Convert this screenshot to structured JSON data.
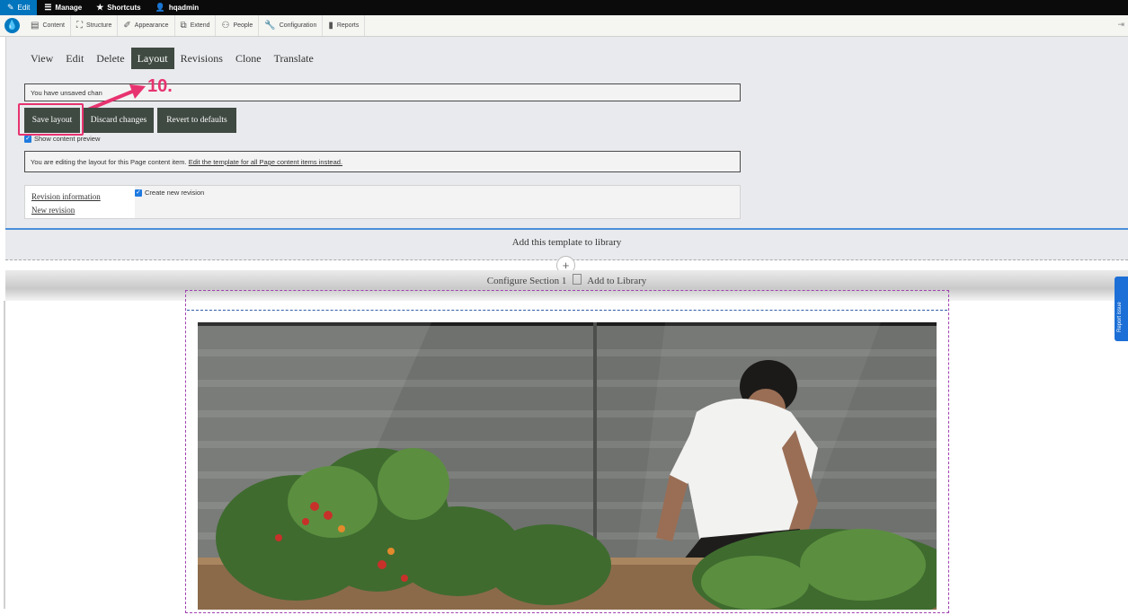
{
  "toolbar": {
    "edit": "Edit",
    "manage": "Manage",
    "shortcuts": "Shortcuts",
    "user": "hqadmin"
  },
  "tray": {
    "items": [
      "Content",
      "Structure",
      "Appearance",
      "Extend",
      "People",
      "Configuration",
      "Reports"
    ]
  },
  "tabs": [
    "View",
    "Edit",
    "Delete",
    "Layout",
    "Revisions",
    "Clone",
    "Translate"
  ],
  "message": "You have unsaved chan",
  "callout": "10.",
  "buttons": {
    "save": "Save layout",
    "discard": "Discard changes",
    "revert": "Revert to defaults"
  },
  "preview_label": "Show content preview",
  "edit_notice": {
    "text": "You are editing the layout for this Page content item.",
    "link": "Edit the template for all Page content items instead."
  },
  "revision": {
    "info_link": "Revision information",
    "new_link": "New revision",
    "create_label": "Create new revision"
  },
  "library": {
    "add_template": "Add this template to library",
    "configure_section": "Configure Section 1",
    "add_to_library": "Add to Library"
  },
  "report_tab": "Report issue",
  "colors": {
    "primary_button": "#3f4a42",
    "accent": "#e7336f",
    "link_blue": "#1f7ae0"
  }
}
